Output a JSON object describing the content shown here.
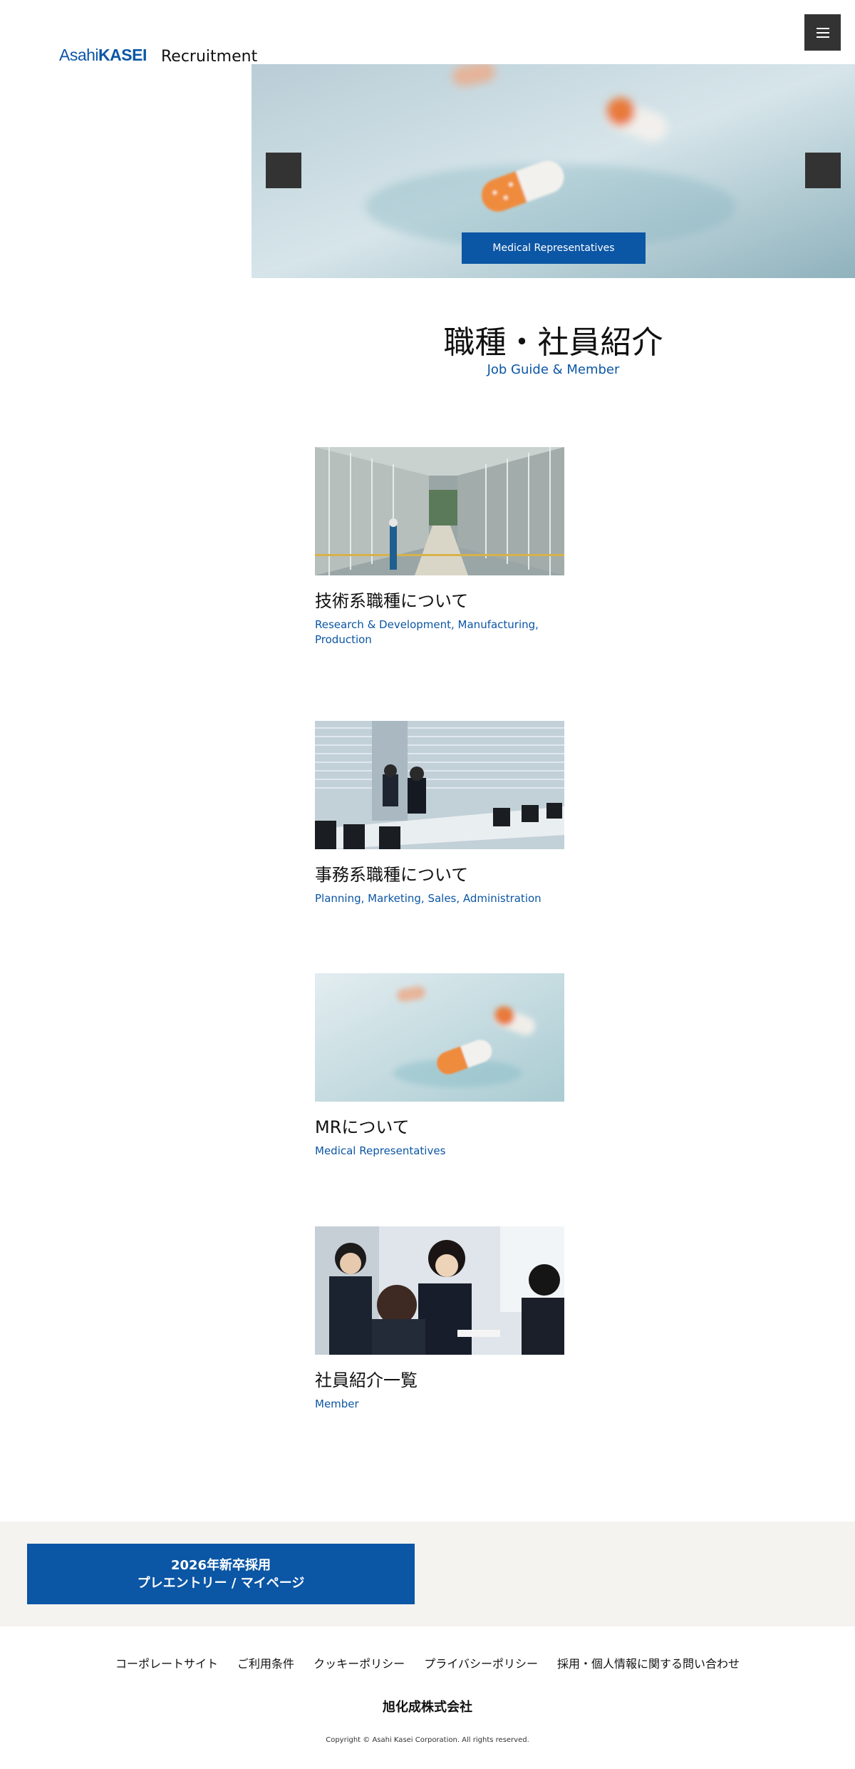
{
  "header": {
    "logo_light": "Asahi",
    "logo_bold": "KASEI",
    "site_label": "Recruitment"
  },
  "hero": {
    "caption": "Medical Representatives"
  },
  "section": {
    "title": "職種・社員紹介",
    "subtitle": "Job Guide & Member"
  },
  "cards": [
    {
      "title": "技術系職種について",
      "subtitle": "Research & Development, Manufacturing, Production"
    },
    {
      "title": "事務系職種について",
      "subtitle": "Planning, Marketing, Sales, Administration"
    },
    {
      "title": "MRについて",
      "subtitle": "Medical Representatives"
    },
    {
      "title": "社員紹介一覧",
      "subtitle": "Member"
    }
  ],
  "cta": {
    "line1": "2026年新卒採用",
    "line2": "プレエントリー / マイページ"
  },
  "footer": {
    "links": [
      "コーポレートサイト",
      "ご利用条件",
      "クッキーポリシー",
      "プライバシーポリシー",
      "採用・個人情報に関する問い合わせ"
    ],
    "company": "旭化成株式会社",
    "copyright": "Copyright © Asahi Kasei Corporation. All rights reserved."
  },
  "colors": {
    "brand_blue": "#0b56a5",
    "dark_button": "#333333",
    "cta_band": "#f4f3ef"
  }
}
